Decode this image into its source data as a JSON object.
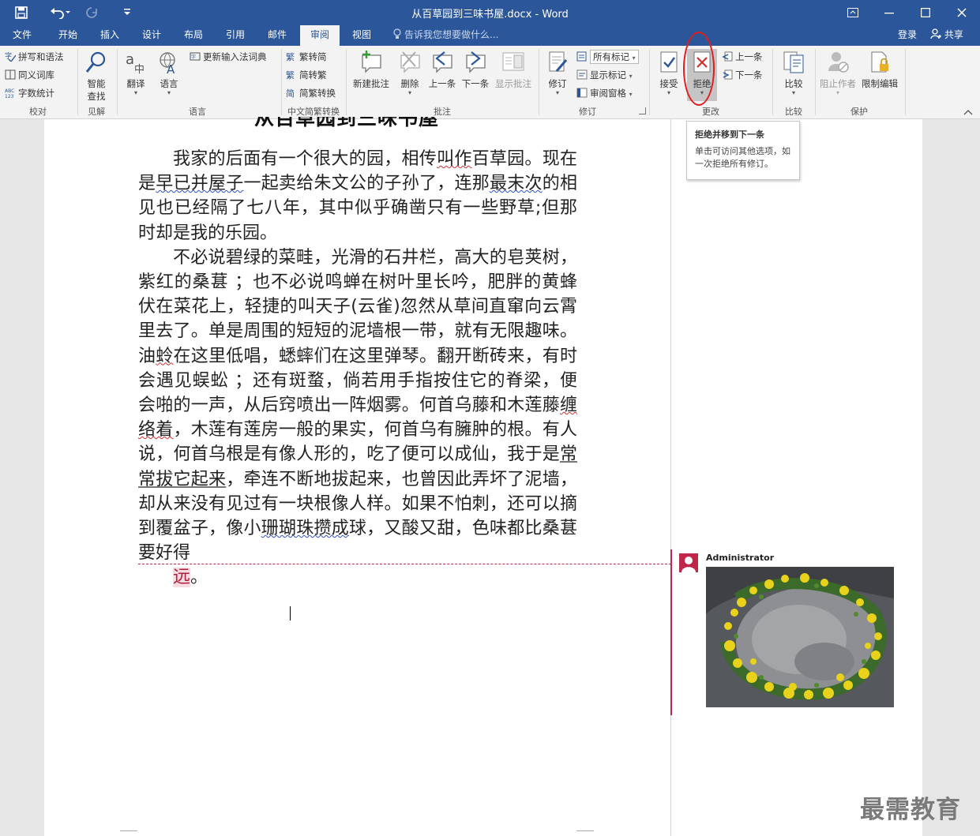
{
  "window": {
    "title": "从百草园到三味书屋.docx - Word",
    "quick_access": [
      "save-icon",
      "undo-icon",
      "redo-icon",
      "customize-icon"
    ]
  },
  "tabs": {
    "items": [
      "文件",
      "开始",
      "插入",
      "设计",
      "布局",
      "引用",
      "邮件",
      "审阅",
      "视图"
    ],
    "active": "审阅",
    "tell_me": "告诉我您想要做什么...",
    "login": "登录",
    "share": "共享"
  },
  "ribbon": {
    "proofing": {
      "label": "校对",
      "spell": "拼写和语法",
      "thesaurus": "同义词库",
      "wordcount": "字数统计"
    },
    "insights": {
      "label": "见解",
      "smart_lookup_1": "智能",
      "smart_lookup_2": "查找"
    },
    "language": {
      "label": "语言",
      "translate": "翻译",
      "lang": "语言",
      "ime": "更新输入法词典"
    },
    "chinese": {
      "label": "中文简繁转换",
      "to_simplified": "繁转简",
      "to_traditional": "简转繁",
      "convert": "简繁转换"
    },
    "comments": {
      "label": "批注",
      "new": "新建批注",
      "delete": "删除",
      "prev": "上一条",
      "next": "下一条",
      "show": "显示批注"
    },
    "tracking": {
      "label": "修订",
      "track": "修订",
      "all_markup": "所有标记",
      "show_markup": "显示标记",
      "pane": "审阅窗格"
    },
    "changes": {
      "label": "更改",
      "accept": "接受",
      "reject": "拒绝",
      "prev": "上一条",
      "next": "下一条"
    },
    "compare": {
      "label": "比较",
      "compare": "比较"
    },
    "protect": {
      "label": "保护",
      "block": "阻止作者",
      "restrict": "限制编辑"
    }
  },
  "tooltip": {
    "title": "拒绝并移到下一条",
    "body": "单击可访问其他选项，如一次拒绝所有修订。"
  },
  "document": {
    "title": "从百草园到三味书屋",
    "p1": {
      "a": "我家的后面有一个很大的园，相传",
      "b": "叫作",
      "c": "百草园。现在是",
      "d": "早已并屋子",
      "e": "一起卖给朱文公的子孙了，连那",
      "f": "最末次",
      "g": "的相见也已经隔了七八年，其中似乎确凿只有一些野草;但那时却是我的乐园。"
    },
    "p2": {
      "a": "不必说碧绿的菜畦，光滑的石井栏，高大的皂荚树，紫红的桑葚 ；也不必说鸣蝉在树叶里长吟，肥胖的黄蜂伏在菜花上，轻捷的叫天子(云雀)忽然从草间直窜向云霄里去了。单是周围的短短的泥墙根一带，就有无限趣味。油",
      "b": "蛉",
      "c": "在这里低唱，蟋蟀们在这里弹琴。翻开断砖来，有时会遇见蜈蚣 ；还有斑蝥，倘若用手指按住它的脊梁，便会啪的一声，从后窍喷出一阵烟雾。何首乌藤和木莲藤",
      "d": "缠络着",
      "e": "，木莲有莲房一般的果实，何首乌有臃肿的根。有人说，何首乌根是有像人形的，吃了便可以成仙，我于是",
      "f": "常常拔它起来",
      "g": "，牵连不断地拔起来，也曾因此弄坏了泥墙，却从来没有见过有一块根像人样。如果不怕刺，还可以摘到覆盆子，像小",
      "h": "珊瑚珠攒成",
      "i": "球，又酸又甜，色味都比桑葚要好得"
    },
    "tail": "远",
    "tail_end": "。"
  },
  "comment": {
    "author": "Administrator"
  },
  "watermark": "最需教育"
}
